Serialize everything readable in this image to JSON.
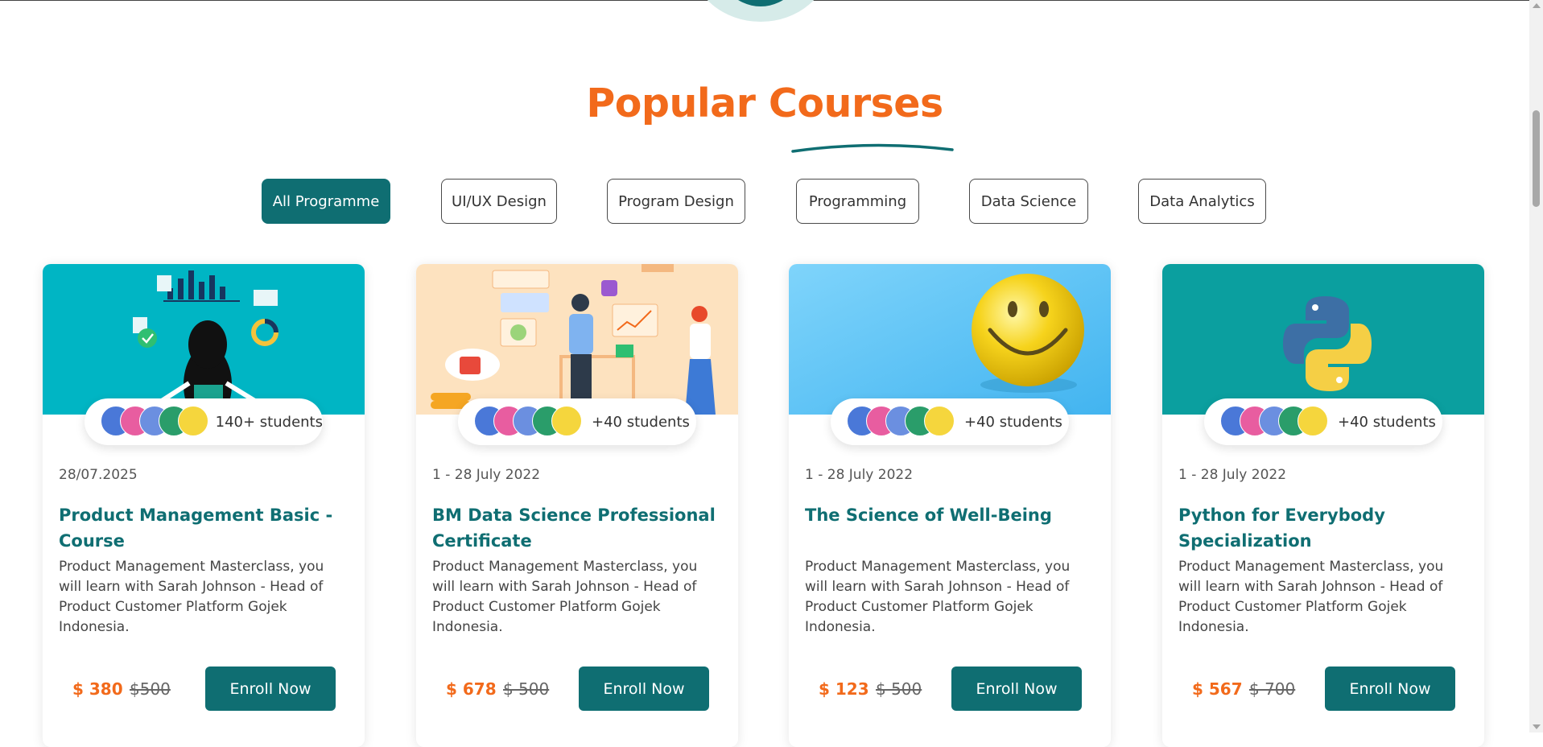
{
  "section": {
    "title": "Popular Courses"
  },
  "filters": [
    "All Programme",
    "UI/UX Design",
    "Program Design",
    "Programming",
    "Data Science",
    "Data Analytics"
  ],
  "active_filter": "All Programme",
  "courses": [
    {
      "students": "140+ students",
      "date": "28/07.2025",
      "title": "Product Management Basic - Course",
      "description": "Product Management Masterclass, you will learn with Sarah Johnson - Head of Product Customer Platform Gojek Indonesia.",
      "price": "$ 380",
      "old_price": "$500",
      "button": "Enroll Now"
    },
    {
      "students": "+40 students",
      "date": "1 - 28 July 2022",
      "title": "BM Data Science Professional Certificate",
      "description": "Product Management Masterclass, you will learn with Sarah Johnson - Head of Product Customer Platform Gojek Indonesia.",
      "price": "$ 678",
      "old_price": "$ 500",
      "button": "Enroll Now"
    },
    {
      "students": "+40 students",
      "date": "1 - 28 July 2022",
      "title": "The Science of Well-Being",
      "description": "Product Management Masterclass, you will learn with Sarah Johnson - Head of Product Customer Platform Gojek Indonesia.",
      "price": "$ 123",
      "old_price": "$ 500",
      "button": "Enroll Now"
    },
    {
      "students": "+40 students",
      "date": "1 - 28 July 2022",
      "title": "Python for Everybody Specialization",
      "description": "Product Management Masterclass, you will learn with Sarah Johnson - Head of Product Customer Platform Gojek Indonesia.",
      "price": "$ 567",
      "old_price": "$ 700",
      "button": "Enroll Now"
    }
  ],
  "colors": {
    "primary": "#0f6e72",
    "accent": "#f26a1b",
    "banner_1": "#00b5c4",
    "banner_2": "#fde2bf",
    "banner_3": "#5cc3f5",
    "banner_4": "#0b9f9f"
  }
}
